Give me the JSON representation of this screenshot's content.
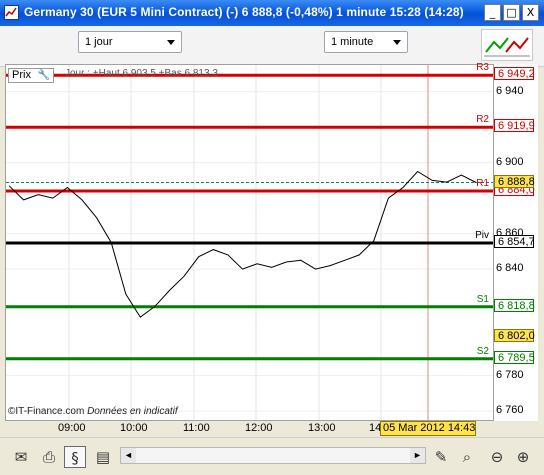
{
  "window": {
    "title": "Germany 30 (EUR 5 Mini Contract) (-)   6 888,8 (-0,48%)   1 minute   15:28 (14:28)",
    "buttons": {
      "minimize": "_",
      "maximize": "□",
      "close": "X"
    }
  },
  "toolbar": {
    "period_select": "1 jour",
    "interval_select": "1 minute"
  },
  "chart": {
    "prix_label": "Prix",
    "day_info": "Jour : +Haut 6 903,5 +Bas 6 813,3",
    "credit_company": "©IT-Finance.com",
    "credit_note": "Données en indicatif",
    "date_marker": "05 Mar 2012 14:43",
    "y_ticks": [
      "6 940",
      "6 900",
      "6 860",
      "6 840",
      "6 780",
      "6 760"
    ],
    "x_ticks": [
      "09:00",
      "10:00",
      "11:00",
      "12:00",
      "13:00",
      "14"
    ],
    "levels": [
      {
        "name": "R3",
        "value": "6 949,2",
        "color": "#d40000"
      },
      {
        "name": "R2",
        "value": "6 919,9",
        "color": "#d40000"
      },
      {
        "name": "R1",
        "value": "6 884,0",
        "color": "#d40000"
      },
      {
        "name": "Piv",
        "value": "6 854,7",
        "color": "#000000"
      },
      {
        "name": "S1",
        "value": "6 818,8",
        "color": "#008000"
      },
      {
        "name": "S2",
        "value": "6 789,5",
        "color": "#008000"
      }
    ],
    "last_price": "6 888,8",
    "cursor_price": "6 802,0",
    "colors": {
      "resistance": "#d40000",
      "pivot": "#000000",
      "support": "#008000",
      "price": "#000000",
      "last_line": "#008080",
      "cursor": "#d88888"
    }
  },
  "chart_data": {
    "type": "line",
    "title": "Germany 30 (EUR 5 Mini Contract)",
    "x": [
      "08:00",
      "08:15",
      "08:30",
      "08:45",
      "09:00",
      "09:15",
      "09:30",
      "09:45",
      "10:00",
      "10:05",
      "10:15",
      "10:30",
      "10:45",
      "11:00",
      "11:15",
      "11:30",
      "11:45",
      "12:00",
      "12:15",
      "12:30",
      "12:45",
      "13:00",
      "13:15",
      "13:30",
      "13:45",
      "14:00",
      "14:05",
      "14:15",
      "14:30",
      "14:45",
      "15:00",
      "15:15",
      "15:28"
    ],
    "series": [
      {
        "values": [
          6887,
          6879,
          6882,
          6880,
          6886,
          6879,
          6869,
          6855,
          6826,
          6813,
          6819,
          6828,
          6836,
          6847,
          6851,
          6848,
          6840,
          6843,
          6841,
          6844,
          6845,
          6840,
          6842,
          6845,
          6848,
          6856,
          6880,
          6886,
          6895,
          6890,
          6889,
          6893,
          6888.8
        ]
      }
    ],
    "ylim": [
      6755,
      6955
    ],
    "grid": true
  },
  "bottom_toolbar": {
    "scroll_left": "◄",
    "scroll_right": "►"
  }
}
